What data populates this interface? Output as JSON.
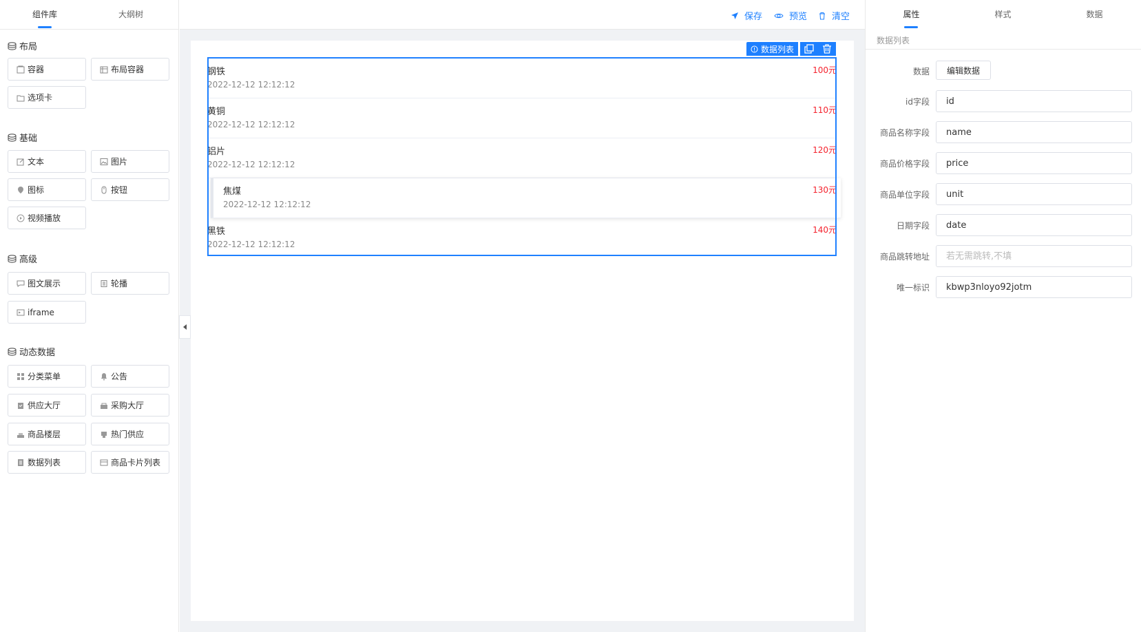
{
  "left": {
    "tabs": [
      "组件库",
      "大纲树"
    ],
    "groups": [
      {
        "title": "布局",
        "items": [
          {
            "label": "容器",
            "icon": "container-icon"
          },
          {
            "label": "布局容器",
            "icon": "layout-container-icon"
          },
          {
            "label": "选项卡",
            "icon": "tabs-icon"
          }
        ]
      },
      {
        "title": "基础",
        "items": [
          {
            "label": "文本",
            "icon": "edit-icon"
          },
          {
            "label": "图片",
            "icon": "image-icon"
          },
          {
            "label": "图标",
            "icon": "location-icon"
          },
          {
            "label": "按钮",
            "icon": "mouse-icon"
          },
          {
            "label": "视频播放",
            "icon": "play-icon"
          }
        ]
      },
      {
        "title": "高级",
        "items": [
          {
            "label": "图文展示",
            "icon": "comment-icon"
          },
          {
            "label": "轮播",
            "icon": "carousel-icon"
          },
          {
            "label": "iframe",
            "icon": "iframe-icon"
          }
        ]
      },
      {
        "title": "动态数据",
        "items": [
          {
            "label": "分类菜单",
            "icon": "grid-icon"
          },
          {
            "label": "公告",
            "icon": "bell-icon"
          },
          {
            "label": "供应大厅",
            "icon": "clipboard-icon"
          },
          {
            "label": "采购大厅",
            "icon": "cart-icon"
          },
          {
            "label": "商品楼层",
            "icon": "cake-icon"
          },
          {
            "label": "热门供应",
            "icon": "hot-icon"
          },
          {
            "label": "数据列表",
            "icon": "list-icon"
          },
          {
            "label": "商品卡片列表",
            "icon": "card-list-icon"
          }
        ]
      }
    ]
  },
  "toolbar": {
    "save": "保存",
    "preview": "预览",
    "clear": "清空"
  },
  "selection": {
    "tag": "数据列表"
  },
  "list": [
    {
      "name": "钢铁",
      "date": "2022-12-12 12:12:12",
      "price": "100元"
    },
    {
      "name": "黄铜",
      "date": "2022-12-12 12:12:12",
      "price": "110元"
    },
    {
      "name": "铝片",
      "date": "2022-12-12 12:12:12",
      "price": "120元"
    },
    {
      "name": "焦煤",
      "date": "2022-12-12 12:12:12",
      "price": "130元"
    },
    {
      "name": "黑铁",
      "date": "2022-12-12 12:12:12",
      "price": "140元"
    }
  ],
  "right": {
    "tabs": [
      "属性",
      "样式",
      "数据"
    ],
    "subtitle": "数据列表",
    "data_label": "数据",
    "edit_button": "编辑数据",
    "fields": [
      {
        "label": "id字段",
        "value": "id",
        "placeholder": ""
      },
      {
        "label": "商品名称字段",
        "value": "name",
        "placeholder": ""
      },
      {
        "label": "商品价格字段",
        "value": "price",
        "placeholder": ""
      },
      {
        "label": "商品单位字段",
        "value": "unit",
        "placeholder": ""
      },
      {
        "label": "日期字段",
        "value": "date",
        "placeholder": ""
      },
      {
        "label": "商品跳转地址",
        "value": "",
        "placeholder": "若无需跳转,不填"
      },
      {
        "label": "唯一标识",
        "value": "kbwp3nloyo92jotm",
        "placeholder": ""
      }
    ]
  },
  "colors": {
    "accent": "#1e80ff",
    "price": "#f5222d"
  }
}
